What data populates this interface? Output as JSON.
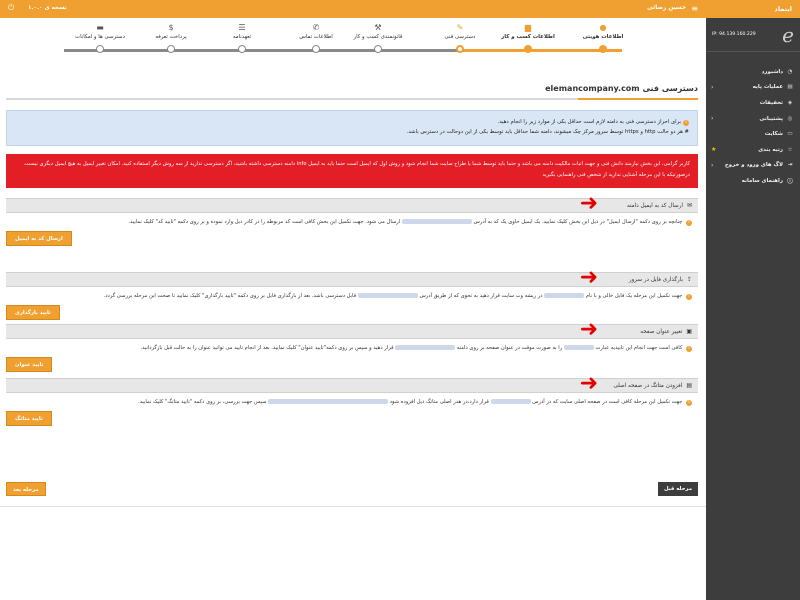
{
  "topbar": {
    "user": "حسین رضائی",
    "version": "نسخه ی ۱.۰.۰"
  },
  "sidebar": {
    "top_title": "ایتماد",
    "ip": "IP: 94.139.160.229",
    "items": [
      {
        "label": "داشبورد",
        "icon": "dashboard-icon"
      },
      {
        "label": "عملیات پایه",
        "icon": "database-icon"
      },
      {
        "label": "تخفیفات",
        "icon": "tag-icon"
      },
      {
        "label": "پشتیبانی",
        "icon": "support-icon"
      },
      {
        "label": "شکایت",
        "icon": "comment-icon"
      },
      {
        "label": "رتبه بندی",
        "icon": "star-icon"
      },
      {
        "label": "لاگ های ورود و خروج",
        "icon": "login-icon"
      },
      {
        "label": "راهنمای سامانه",
        "icon": "info-icon"
      }
    ]
  },
  "stepper": {
    "steps": [
      {
        "label": "اطلاعات هویتی",
        "state": "done",
        "icon": "user-icon"
      },
      {
        "label": "اطلاعات کسب و کار",
        "state": "done",
        "icon": "document-icon"
      },
      {
        "label": "دسترسی فنی",
        "state": "current",
        "icon": "wrench-icon"
      },
      {
        "label": "قانونمندی کسب و کار",
        "state": "todo",
        "icon": "gavel-icon"
      },
      {
        "label": "اطلاعات تماس",
        "state": "todo",
        "icon": "phone-icon"
      },
      {
        "label": "تعهدنامه",
        "state": "todo",
        "icon": "handshake-icon"
      },
      {
        "label": "پرداخت تعرفه",
        "state": "todo",
        "icon": "dollar-icon"
      },
      {
        "label": "دسترسی ها و امکانات",
        "state": "todo",
        "icon": "folder-icon"
      }
    ]
  },
  "page": {
    "title_prefix": "دسترسی فنی",
    "domain": "elemancompany.com"
  },
  "info": {
    "line1": "برای احراز دسترسی فنی به دامنه لازم است حداقل یکی از موارد زیر را انجام دهید.",
    "line2": "# هر دو حالت http و https توسط سرور مرکز چک میشوند، دامنه شما حداقل باید توسط یکی از این دوحالت در دسترس باشد."
  },
  "alert": {
    "text": "کاربر گرامی، این بخش نیازمند دانش فنی و جهت اثبات مالکیت دامنه می باشد و حتما باید توسط شما یا طراح سایت شما انجام شود و روش اول که ایمیل است حتما باید به ایمیل info دامنه دسترسی داشته باشید، اگر دسترسی ندارید از سه روش دیگر استفاده کنید. امکان تغییر ایمیل به هیچ ایمیل دیگری نیست. درصورتیکه با این مرحله آشنایی ندارید از شخص فنی راهنمایی بگیرید"
  },
  "sections": [
    {
      "title": "ارسال کد به ایمیل دامنه",
      "icon": "envelope-icon",
      "text_a": "چنانچه بر روی دکمه \"ارسال ایمیل\" در ذیل این بخش کلیک نمایید، یک ایمیل حاوی یک کد به آدرس",
      "text_b": "ارسال می شود. جهت تکمیل این بخش کافی است کد مربوطه را در کادر ذیل وارد نموده و بر روی دکمه \"تایید کد\" کلیک نمایید.",
      "button": "ارسال کد به ایمیل"
    },
    {
      "title": "بارگذاری فایل در سرور",
      "icon": "upload-icon",
      "text_a": "جهت تکمیل این مرحله یک فایل خالی و با نام",
      "text_b": "در ریشه وب سایت قرار دهید به نحوی که از طریق آدرس",
      "text_c": "قابل دسترسی باشد. بعد از بارگذاری فایل بر روی دکمه \"تایید بارگذاری\" کلیک نمایید تا صحت این مرحله بررسی گردد.",
      "button": "تایید بارگذاری"
    },
    {
      "title": "تغییر عنوان صفحه",
      "icon": "file-icon",
      "text_a": "کافی است جهت انجام این تاییدیه عبارت",
      "text_b": "را به صورت موقت در عنوان صفحه بر روی دامنه",
      "text_c": "قرار دهید و سپس بر روی دکمه\"تایید عنوان\" کلیک نمایید. بعد از انجام تایید می توانید عنوان را به حالت قبل بازگردانید.",
      "button": "تایید عنوان"
    },
    {
      "title": "افزودن متاتگ در صفحه اصلی",
      "icon": "file-alt-icon",
      "text_a": "جهت تکمیل این مرحله کافی است در صفحه اصلی سایت که در آدرس",
      "text_b": "قرار دارد،در هدر اصلی متاتگ ذیل افزوده شود",
      "text_c": "سپس جهت بررسی، بر روی دکمه \"تایید متاتگ\" کلیک نمایید.",
      "button": "تایید متاتگ"
    }
  ],
  "footer": {
    "prev": "مرحله قبل",
    "next": "مرحله بعد"
  }
}
